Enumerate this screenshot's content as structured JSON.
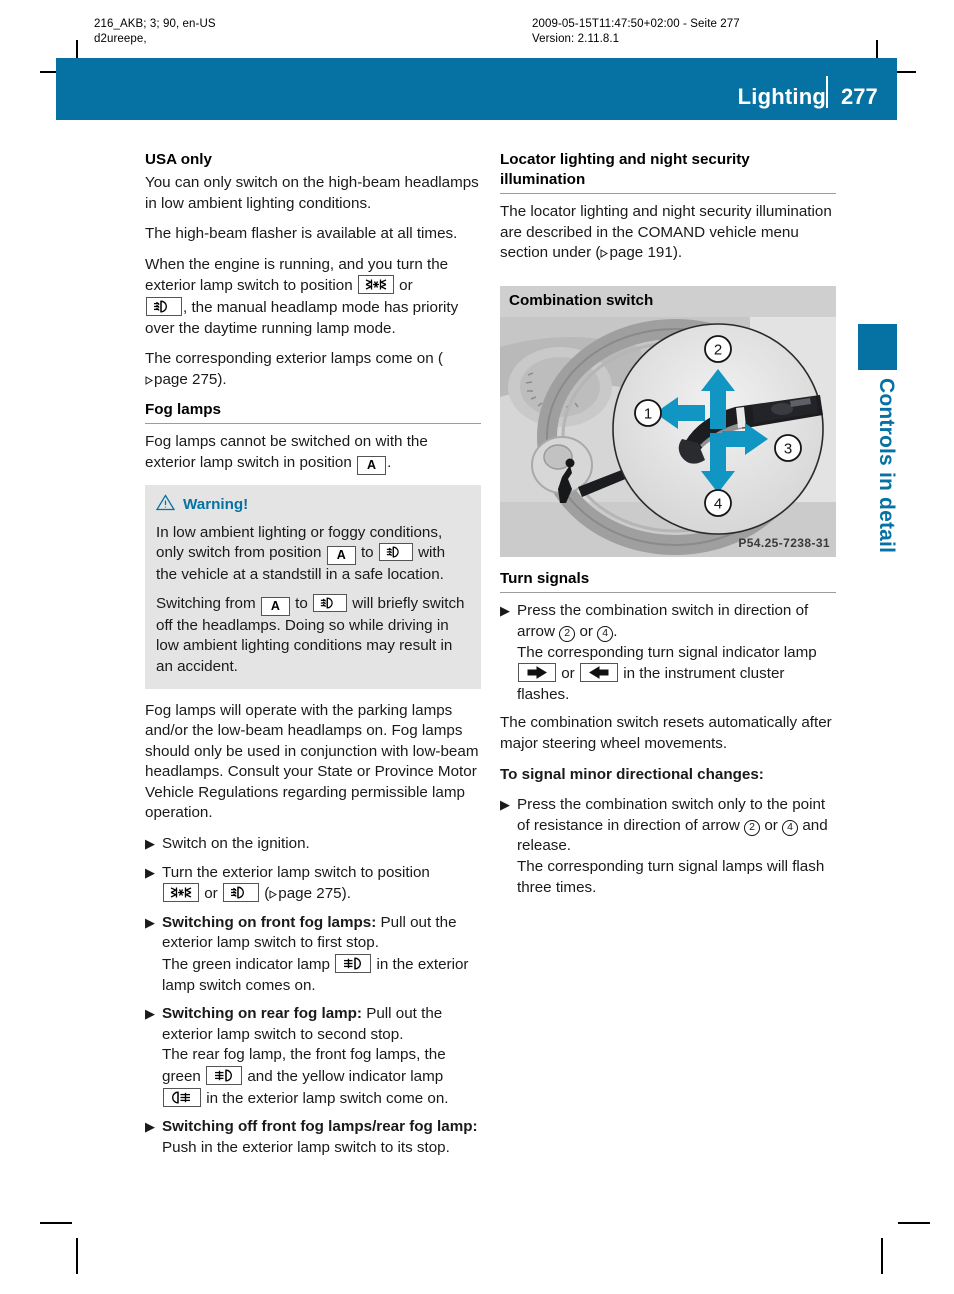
{
  "print_marks": {
    "left_line1": "216_AKB; 3; 90, en-US",
    "left_line2": "d2ureepe,",
    "right_line1": "2009-05-15T11:47:50+02:00 - Seite 277",
    "right_line2": "Version: 2.11.8.1"
  },
  "header": {
    "title": "Lighting",
    "page_number": "277",
    "band_color": "#0672a3"
  },
  "thumb_tab": {
    "label": "Controls in detail"
  },
  "left_column": {
    "usa_only": {
      "heading": "USA only",
      "para1": "You can only switch on the high-beam headlamps in low ambient lighting conditions.",
      "para2": "The high-beam flasher is available at all times.",
      "para3_a": "When the engine is running, and you turn the exterior lamp switch to position",
      "para3_or": "or",
      "para3_b": ", the manual headlamp mode has priority over the daytime running lamp mode.",
      "para4_a": "The corresponding exterior lamps come on (",
      "para4_page": "page 275",
      "para4_b": ")."
    },
    "fog_lamps": {
      "heading": "Fog lamps",
      "intro_a": "Fog lamps cannot be switched on with the exterior lamp switch in position",
      "intro_b": ".",
      "warning": {
        "label": "Warning!",
        "p1_a": "In low ambient lighting or foggy conditions, only switch from position",
        "p1_to": "to",
        "p1_b": "with the vehicle at a standstill in a safe location.",
        "p2_a": "Switching from",
        "p2_to": "to",
        "p2_b": "will briefly switch off the headlamps. Doing so while driving in low ambient lighting conditions may result in an accident."
      },
      "para_after_warning": "Fog lamps will operate with the parking lamps and/or the low-beam headlamps on. Fog lamps should only be used in conjunction with low-beam headlamps. Consult your State or Province Motor Vehicle Regulations regarding permissible lamp operation.",
      "steps": [
        {
          "text": "Switch on the ignition."
        },
        {
          "text_a": "Turn the exterior lamp switch to position",
          "text_or": "or",
          "text_b": "(",
          "page": "page 275",
          "text_c": ")."
        },
        {
          "bold": "Switching on front fog lamps:",
          "text_a": "Pull out the exterior lamp switch to first stop.",
          "text_b": "The green indicator lamp",
          "text_c": "in the exterior lamp switch comes on."
        },
        {
          "bold": "Switching on rear fog lamp:",
          "text_a": "Pull out the exterior lamp switch to second stop.",
          "text_b": "The rear fog lamp, the front fog lamps, the green",
          "text_c": "and the yellow indicator lamp",
          "text_d": "in the exterior lamp switch come on."
        },
        {
          "bold": "Switching off front fog lamps/rear fog lamp:",
          "text_a": "Push in the exterior lamp switch to its stop."
        }
      ]
    }
  },
  "right_column": {
    "locator": {
      "heading": "Locator lighting and night security illumination",
      "para_a": "The locator lighting and night security illumination are described in the COMAND vehicle menu section under (",
      "page": "page 191",
      "para_b": ")."
    },
    "combination_switch": {
      "bar_label": "Combination switch",
      "figure_caption": "P54.25-7238-31",
      "callouts": [
        "1",
        "2",
        "3",
        "4"
      ]
    },
    "turn_signals": {
      "heading": "Turn signals",
      "step1": {
        "text_a": "Press the combination switch in direction of arrow",
        "num1": "2",
        "text_or": "or",
        "num2": "4",
        "text_b": ".",
        "text_c": "The corresponding turn signal indicator lamp",
        "text_or2": "or",
        "text_d": "in the instrument cluster flashes."
      },
      "reset_note": "The combination switch resets automatically after major steering wheel movements.",
      "minor_heading": "To signal minor directional changes:",
      "step2": {
        "text_a": "Press the combination switch only to the point of resistance in direction of arrow",
        "num1": "2",
        "text_or": "or",
        "num2": "4",
        "text_b": "and release.",
        "text_c": "The corresponding turn signal lamps will flash three times."
      }
    }
  },
  "icons": {
    "parking_lamp": "parking-lamp-icon",
    "low_beam": "low-beam-headlamp-icon",
    "auto_position": "A",
    "front_fog": "front-fog-lamp-icon",
    "rear_fog": "rear-fog-lamp-icon",
    "turn_right": "turn-signal-right-icon",
    "turn_left": "turn-signal-left-icon",
    "warning_triangle": "warning-triangle-icon"
  }
}
